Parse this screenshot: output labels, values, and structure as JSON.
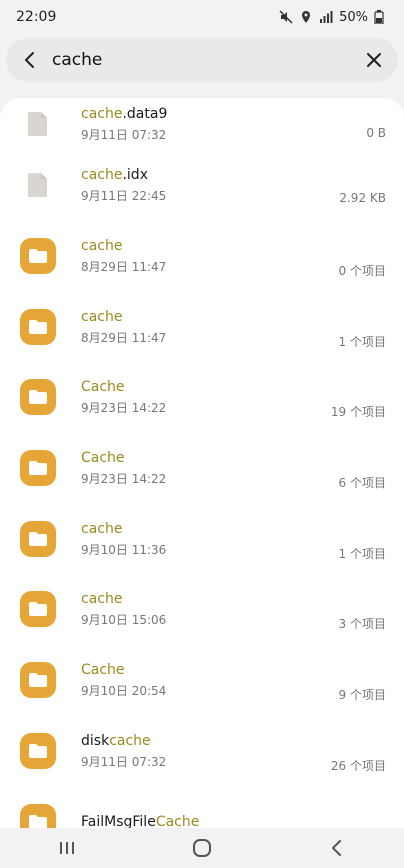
{
  "status_bar": {
    "time": "22:09",
    "battery": "50%"
  },
  "search": {
    "query": "cache"
  },
  "files": [
    {
      "type": "file",
      "pre": "",
      "match": "cache",
      "post": ".data9",
      "date": "9月11日 07:32",
      "size": "0 B"
    },
    {
      "type": "file",
      "pre": "",
      "match": "cache",
      "post": ".idx",
      "date": "9月11日 22:45",
      "size": "2.92 KB"
    },
    {
      "type": "folder",
      "pre": "",
      "match": "cache",
      "post": "",
      "date": "8月29日 11:47",
      "size": "0 个项目"
    },
    {
      "type": "folder",
      "pre": "",
      "match": "cache",
      "post": "",
      "date": "8月29日 11:47",
      "size": "1 个项目"
    },
    {
      "type": "folder",
      "pre": "",
      "match": "Cache",
      "post": "",
      "date": "9月23日 14:22",
      "size": "19 个项目"
    },
    {
      "type": "folder",
      "pre": "",
      "match": "Cache",
      "post": "",
      "date": "9月23日 14:22",
      "size": "6 个项目"
    },
    {
      "type": "folder",
      "pre": "",
      "match": "cache",
      "post": "",
      "date": "9月10日 11:36",
      "size": "1 个项目"
    },
    {
      "type": "folder",
      "pre": "",
      "match": "cache",
      "post": "",
      "date": "9月10日 15:06",
      "size": "3 个项目"
    },
    {
      "type": "folder",
      "pre": "",
      "match": "Cache",
      "post": "",
      "date": "9月10日 20:54",
      "size": "9 个项目"
    },
    {
      "type": "folder",
      "pre": "disk",
      "match": "cache",
      "post": "",
      "date": "9月11日 07:32",
      "size": "26 个项目"
    },
    {
      "type": "folder",
      "pre": "FailMsgFile",
      "match": "Cache",
      "post": "",
      "date": "",
      "size": ""
    }
  ],
  "colors": {
    "highlight": "#9b8a1e",
    "folder": "#e5a637",
    "file_icon": "#d9d6d1"
  },
  "icons": {
    "mute": "mute-icon",
    "location": "location-icon",
    "signal": "signal-icon",
    "battery": "battery-icon",
    "back": "back-arrow-icon",
    "clear": "close-icon",
    "folder": "folder-icon",
    "file": "file-icon",
    "nav_recents": "recents-icon",
    "nav_home": "home-icon",
    "nav_back": "nav-back-icon"
  }
}
